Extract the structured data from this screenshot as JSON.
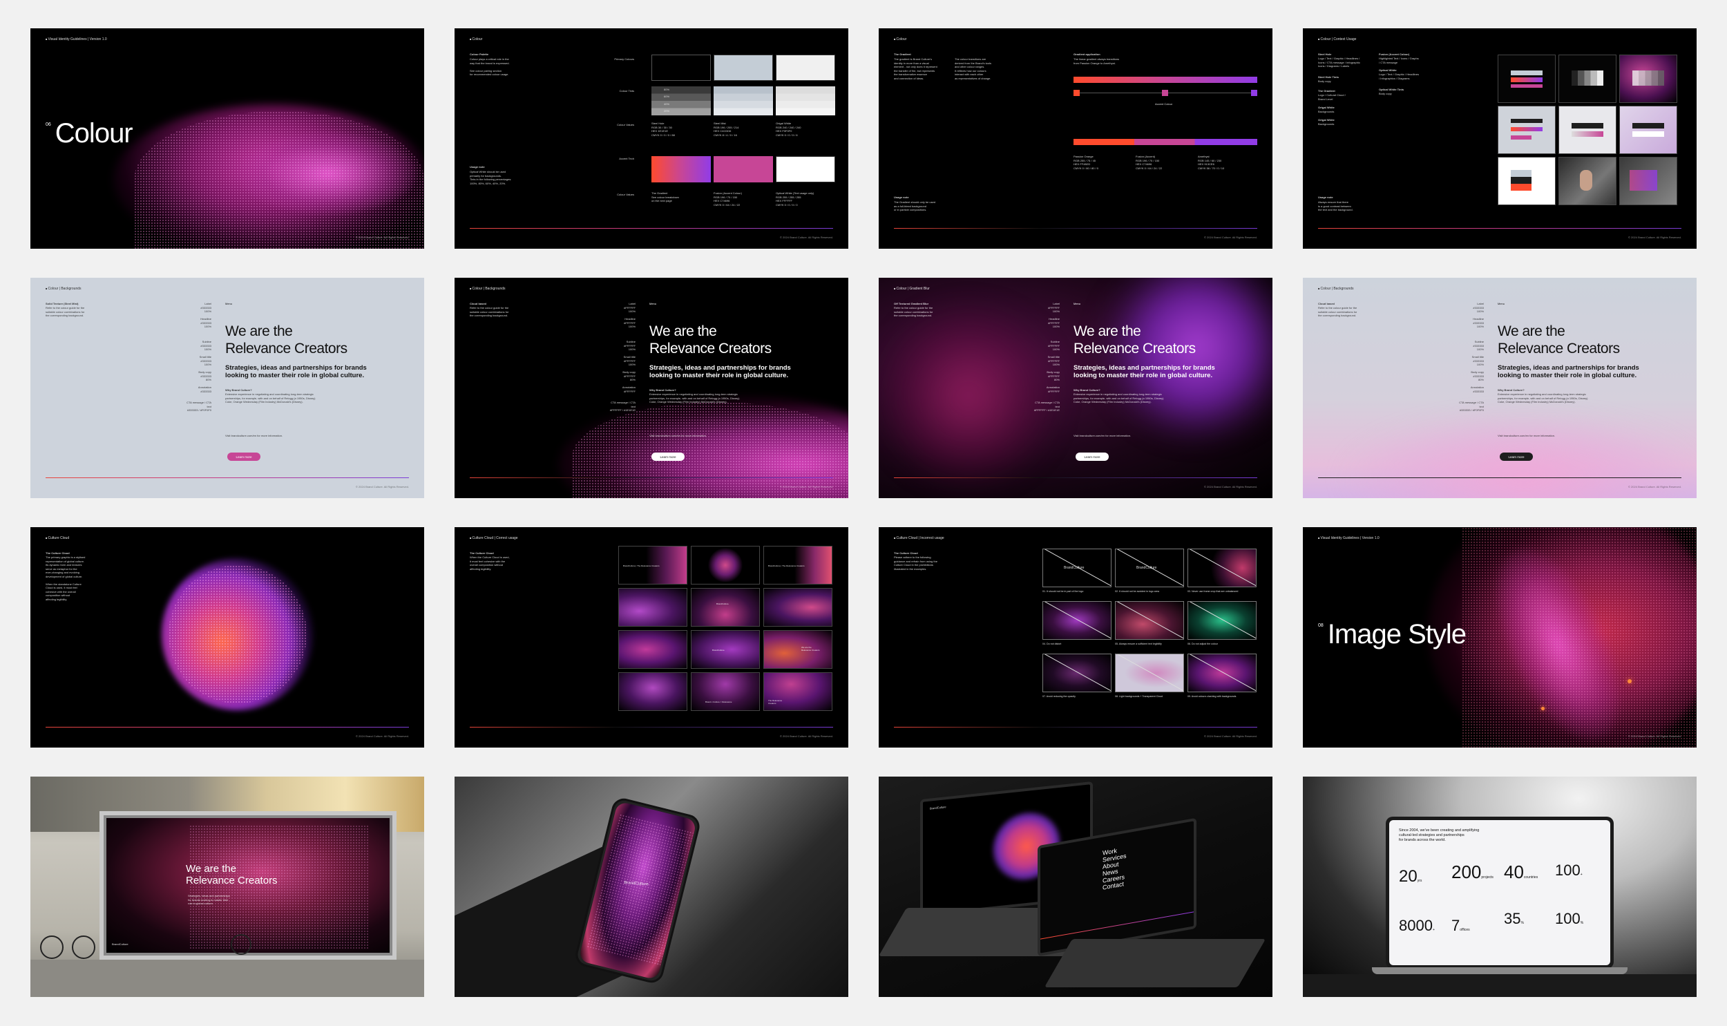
{
  "slides": {
    "colour_intro": {
      "tag": "Visual Identity Guidelines | Version 1.0",
      "num": "06",
      "title": "Colour"
    },
    "palette": {
      "tag": "Colour",
      "intro_title": "Colour Palette",
      "intro_body": "Colour plays a critical role in the\nway that the brand is expressed.\n\nSee colour pairing section\nfor recommended colour usage.",
      "usage_title": "Usage note",
      "usage_body": "Optical White should be used\nprimarily for backgrounds.\nTints in the following percentages:\n100%, 80%, 60%, 40%, 20%.",
      "row_primary": "Primary Colours",
      "row_tints": "Colour Tints",
      "row_values": "Colour Values",
      "row_accent": "Accent Tech",
      "row_values2": "Colour Values",
      "tint_pcts": [
        "80%",
        "60%",
        "40%",
        "20%"
      ],
      "v1": "Steel Hole\nRGB  30 / 30 / 30\nHEX  1E1E1E\nCMYK  0 / 0 / 0 / 88",
      "v2": "Steel Mist\nRGB  196 / 205 / 214\nHEX  C4CDD6\nCMYK  8 / 4 / 0 / 16",
      "v3": "Ortgal White\nRGB  240 / 240 / 240\nHEX  F0F0F0\nCMYK  0 / 0 / 0 / 6",
      "a1": "The Gradient\nSee colour breakdown\non the next page",
      "a2": "Fusion (Accent Colour)\nRGB  196 / 70 / 150\nHEX  C74696\nCMYK  0 / 64 / 24 / 22",
      "a3": "Optical White (Text usage only)\nRGB  255 / 255 / 255\nHEX  FFFFFF\nCMYK  0 / 0 / 0 / 0"
    },
    "gradient": {
      "tag": "Colour",
      "t1": "The Gradient",
      "b1": "The gradient is Brand Culture's\nidentity in more than a visual\nelement - not only does it represent\nthe transfer of fire, but represents\nthe transformative essence\nand connection of ideas.",
      "b2": "The colour transitions are\nderived from the Brand's tools\nand other colour ranges.\nIt reflects how our colours\ninteract with each other\nas representatives of change.",
      "app": "Gradient application",
      "app_body": "The linear gradient always transitions\nfrom Passion Orange to Amethyst.",
      "accent": "Accent Colour",
      "c1": "Passion Orange\nRGB  255 / 75 / 45\nHEX  FF4B2D\nCMYK  0 / 80 / 80 / 0",
      "c2": "Fusion (Accent)\nRGB  196 / 70 / 150\nHEX  C74696\nCMYK  0 / 64 / 24 / 22",
      "c3": "Amethyst\nRGB  145 / 60 / 230\nHEX  913CE6\nCMYK  56 / 70 / 0 / 10",
      "usage": "Usage note",
      "usage_b": "The Gradient should only be used\nas a full-bleed background\nor in particle compositions."
    },
    "context": {
      "tag": "Colour | Context Usage",
      "l1": "Steel Hole",
      "l1b": "Logo / Text / Graphic / Headlines /\nIcons / CTA message / Infographic\nIcons / Diagrams / Labels",
      "l2": "Steel Hole Tints",
      "l2b": "Body copy",
      "l3": "The Gradient",
      "l3b": "Logo / Cultural Cloud /\nBrand Level",
      "l4": "Ortgal White",
      "l4b": "Backgrounds",
      "l5": "Ortgal White",
      "l5b": "Backgrounds",
      "r1": "Fusion (Accent Colour)",
      "r1b": "Highlighted Text / Icons / Graphs\n/ CTA message",
      "r2": "Optical White",
      "r2b": "Logo / Text / Graphic / Headlines\n/ Infographics / Diagrams",
      "r3": "Optical White Tints",
      "r3b": "Body copy",
      "usage": "Usage note",
      "usage_b": "Always ensure that there\nis a good contrast between\nthe text and the background."
    },
    "bg_common": {
      "menu": "Menu",
      "head1": "We are the",
      "head2": "Relevance Creators",
      "sub": "Strategies, ideas and partnerships for brands looking to master their role in global culture.",
      "why_t": "Why Brand Culture?",
      "why_b": "Extensive experience in negotiating and coordinating long-term strategic\npartnerships, for example, with and on behalf of Relogg (a 1950s, Disney)\nCoke, Orange Wednesday (Film Industry) McDonald's (Disney).",
      "visit": "Visit brandculture.com/en for more information.",
      "btn": "Learn more",
      "labels": "Label\n#333333\n100%\n\nHeadline\n#333333\n100%\n\n\n\nSubline\n#333333\n100%\n\nSmall title\n#333333\n100%\n\nBody copy\n#333333\n80%\n\nAnnotation\n#333333\n\n\nCTA message / CTA text\n#333333 / #F0F0F0",
      "labels_dark": "Label\n#FFFFFF\n100%\n\nHeadline\n#FFFFFF\n100%\n\n\n\nSubline\n#FFFFFF\n100%\n\nSmall title\n#FFFFFF\n100%\n\nBody copy\n#FFFFFF\n80%\n\nAnnotation\n#FFFFFF\n\n\nCTA message / CTA text\n#FFFFFF / #1E1E1E"
    },
    "bg1": {
      "tag": "Colour | Backgrounds",
      "title": "Solid Texture (Steel Mist)",
      "body": "Refer to the colour guide for the\nsuitable colour combinations for\nthe corresponding background."
    },
    "bg2": {
      "tag": "Colour | Backgrounds",
      "title": "Cloud based",
      "body": "Refer to the colour guide for the\nsuitable colour combinations for\nthe corresponding background."
    },
    "bg3": {
      "tag": "Colour | Gradient Blur",
      "title": "Off Textured Gradient Blur",
      "body": "Refer to the colour guide for the\nsuitable colour combinations for\nthe corresponding background."
    },
    "bg4": {
      "tag": "Colour | Backgrounds",
      "title": "Cloud based",
      "body": "Refer to the colour guide for the\nsuitable colour combinations for\nthe corresponding background."
    },
    "cloud": {
      "tag": "Culture Cloud",
      "title": "The Culture Cloud",
      "body": "The primary graphic is a stylised\nrepresentation of global culture.\nIts dynamic form and textures\nserve as metaphor for the\never-changing and evolving\ndevelopment of global culture.\n\nWhen the standalone Culture\nCloud is used, it must feel\ncohesive with the overall\ncomposition without\naffecting legibility."
    },
    "usage": {
      "tag": "Culture Cloud | Correct usage",
      "title": "The Culture Cloud",
      "body": "When the Culture Cloud is used,\nit must feel cohesive with the\noverall composition without\naffecting legibility.",
      "thumb_texts": [
        "BrandCulture  |  The Relevance Creators",
        "BrandCulture  |  The Relevance Creators",
        "BrandCulture",
        "BrandCulture",
        "We are the\nRelevance Creators",
        "Brand x Culture = Relevance",
        "The Relevance\nCreators"
      ]
    },
    "incorrect": {
      "tag": "Culture Cloud | Incorrect usage",
      "title": "The Culture Cloud",
      "body": "Please adhere to the following\nguidance and refrain from using the\nCulture Cloud in the prohibitions\nillustrated in the examples.",
      "captions": [
        "01. It should not be in part of the logo",
        "02. It should not be avoided in logo area",
        "03. Never use frame crop that are unbalanced",
        "04. Do not distort",
        "05. Always ensure a sufficient text legibility",
        "06. Do not adjust the colour",
        "07. Avoid reducing the opacity",
        "08. Light backgrounds + Transparent Cloud",
        "09. Avoid colours clashing with backgrounds"
      ],
      "brand": "BrandCulture"
    },
    "image_style": {
      "tag": "Visual Identity Guidelines | Version 1.0",
      "num": "08",
      "title": "Image Style"
    },
    "billboard": {
      "head1": "We are the",
      "head2": "Relevance Creators",
      "sub": "Strategies, ideas and partnerships\nfor brands looking to master their\nrole in global culture.",
      "brand": "BrandCulture"
    },
    "phone": {
      "brand": "BrandCulture"
    },
    "laptops": {
      "menu": [
        "Work",
        "Services",
        "About",
        "News",
        "Careers",
        "Contact"
      ],
      "brand": "BrandCulture"
    },
    "laptop_stats": {
      "intro": "Since 2004, we've been creating and amplifying\ncultural-led strategies and partnerships\nfor brands across the world.",
      "stats": [
        {
          "n": "20",
          "u": "yrs"
        },
        {
          "n": "200",
          "u": "projects"
        },
        {
          "n": "40",
          "u": "countries"
        },
        {
          "n": "100",
          "u": "+"
        },
        {
          "n": "8000",
          "u": "+"
        },
        {
          "n": "7",
          "u": "offices"
        },
        {
          "n": "35",
          "u": "%"
        },
        {
          "n": "100",
          "u": "%"
        }
      ]
    }
  },
  "footer_text": "© 2024 Brand Culture. All Rights Reserved.",
  "colors": {
    "steel_hole": "#1E1E1E",
    "steel_mist": "#C4CDD6",
    "ortgal_white": "#F0F0F0",
    "passion_orange": "#FF4B2D",
    "fusion": "#C74696",
    "amethyst": "#913CE6"
  }
}
